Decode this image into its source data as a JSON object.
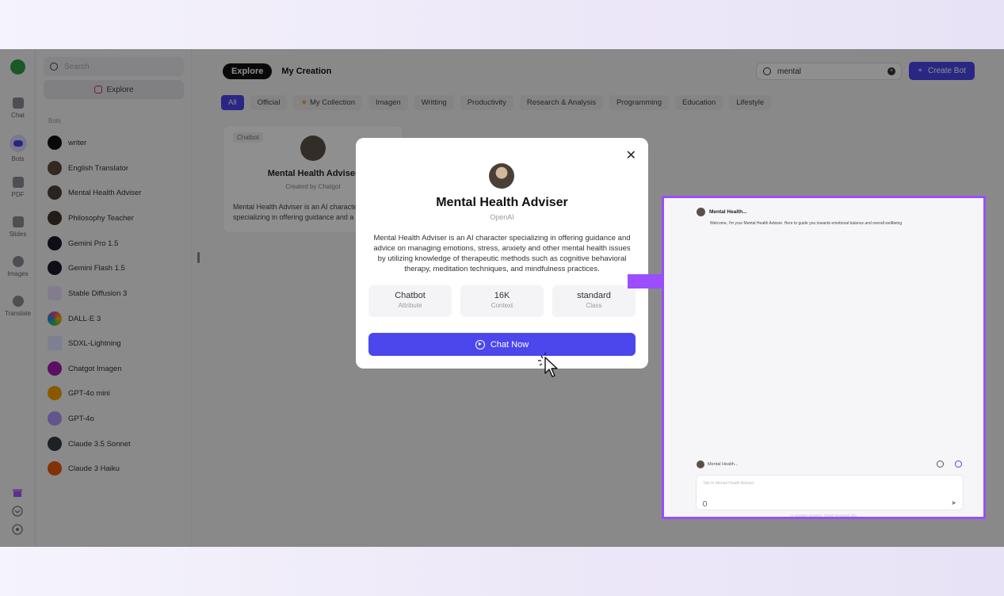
{
  "rail": {
    "items": [
      {
        "label": "Chat",
        "icon": "chat-icon"
      },
      {
        "label": "Bots",
        "icon": "bots-icon"
      },
      {
        "label": "PDF",
        "icon": "pdf-icon"
      },
      {
        "label": "Slides",
        "icon": "slides-icon"
      },
      {
        "label": "Images",
        "icon": "images-icon"
      },
      {
        "label": "Translate",
        "icon": "translate-icon"
      }
    ],
    "bottom_icons": [
      "gift-icon",
      "download-icon",
      "settings-icon"
    ]
  },
  "sidebar": {
    "search_placeholder": "Search",
    "explore_label": "Explore",
    "bots_heading": "Bots",
    "bots": [
      {
        "name": "writer"
      },
      {
        "name": "English Translator"
      },
      {
        "name": "Mental Health Adviser"
      },
      {
        "name": "Philosophy Teacher"
      },
      {
        "name": "Gemini Pro 1.5"
      },
      {
        "name": "Gemini Flash 1.5"
      },
      {
        "name": "Stable Diffusion 3"
      },
      {
        "name": "DALL·E 3"
      },
      {
        "name": "SDXL-Lightning"
      },
      {
        "name": "Chatgot Imagen"
      },
      {
        "name": "GPT-4o mini"
      },
      {
        "name": "GPT-4o"
      },
      {
        "name": "Claude 3.5 Sonnet"
      },
      {
        "name": "Claude 3 Haiku"
      }
    ]
  },
  "main": {
    "tabs": [
      "Explore",
      "My Creation"
    ],
    "search_value": "mental",
    "create_label": "Create Bot",
    "categories": [
      "All",
      "Official",
      "My Collection",
      "Imagen",
      "Writting",
      "Productivity",
      "Research & Analysis",
      "Programming",
      "Education",
      "Lifestyle"
    ],
    "card": {
      "tag": "Chatbot",
      "name": "Mental Health Adviser",
      "by": "Created by Chatgot",
      "desc": "Mental Health Adviser is an AI character specializing in offering guidance and a"
    }
  },
  "modal": {
    "title": "Mental Health Adviser",
    "subtitle": "OpenAI",
    "description": "Mental Health Adviser is an AI character specializing in offering guidance and advice on managing emotions, stress, anxiety and other mental health issues by utilizing knowledge of therapeutic methods such as cognitive behavioral therapy, meditation techniques, and mindfulness practices.",
    "stats": [
      {
        "value": "Chatbot",
        "label": "Attribute"
      },
      {
        "value": "16K",
        "label": "Context"
      },
      {
        "value": "standard",
        "label": "Class"
      }
    ],
    "chat_button": "Chat Now"
  },
  "preview": {
    "header": "Mental Health...",
    "message": "Welcome, I'm your Mental Health Adviser. Here to guide you towards emotional balance and overall wellbeing",
    "bot_label": "Mental Health...",
    "input_placeholder": "Talk to Mental Health Adviser",
    "footer": "AI provides answers. Check important info."
  },
  "colors": {
    "accent": "#4b47ec",
    "highlight_border": "#9c4dfa",
    "arrow": "#9b4dff"
  }
}
